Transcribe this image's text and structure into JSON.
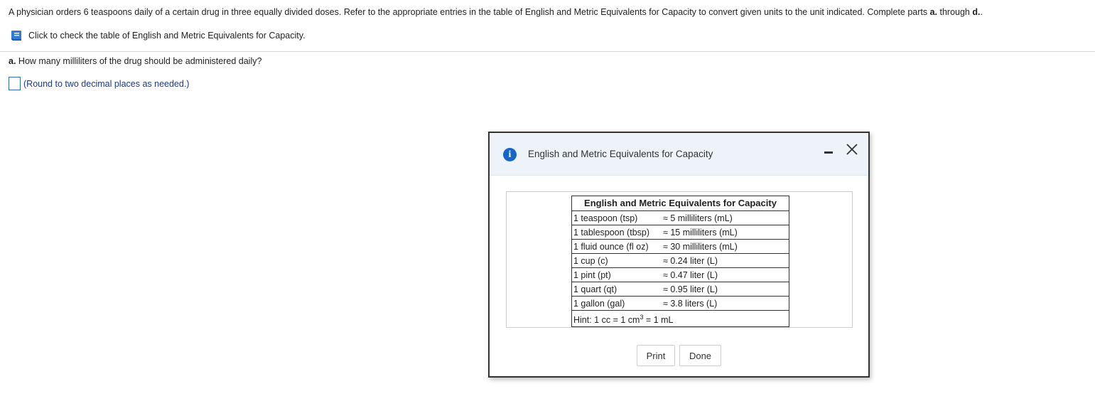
{
  "question": {
    "text_prefix": "A physician orders 6 teaspoons daily of a certain drug in three equally divided doses. Refer to the appropriate entries in the table of English and Metric Equivalents for Capacity to convert given units to the unit indicated. Complete parts ",
    "part_first": "a.",
    "text_mid": " through ",
    "part_last": "d.",
    "text_suffix": "."
  },
  "table_link": {
    "icon": "book-icon",
    "label": "Click to check the table of English and Metric Equivalents for Capacity."
  },
  "part_a": {
    "label": "a.",
    "question": " How many milliliters of the drug should be administered daily?",
    "answer_value": "",
    "hint": "(Round to two decimal places as needed.)"
  },
  "dialog": {
    "icon": "info-icon",
    "title": "English and Metric Equivalents for Capacity",
    "table_heading": "English and Metric Equivalents for Capacity",
    "rows": [
      {
        "english": "1 teaspoon (tsp)",
        "metric": "≈ 5 milliliters (mL)"
      },
      {
        "english": "1 tablespoon (tbsp)",
        "metric": "≈ 15 milliliters (mL)"
      },
      {
        "english": "1 fluid ounce (fl oz)",
        "metric": "≈ 30 milliliters (mL)"
      },
      {
        "english": "1 cup (c)",
        "metric": "≈ 0.24 liter (L)"
      },
      {
        "english": "1 pint (pt)",
        "metric": "≈ 0.47 liter (L)"
      },
      {
        "english": "1 quart (qt)",
        "metric": "≈ 0.95 liter (L)"
      },
      {
        "english": "1 gallon (gal)",
        "metric": "≈ 3.8 liters (L)"
      }
    ],
    "hint_prefix": "Hint: 1 cc = 1 cm",
    "hint_sup": "3",
    "hint_suffix": " = 1 mL",
    "print_label": "Print",
    "done_label": "Done"
  },
  "colors": {
    "accent": "#1466c9",
    "hint_text": "#1a3a8f",
    "dialog_header": "#eef3fa"
  }
}
